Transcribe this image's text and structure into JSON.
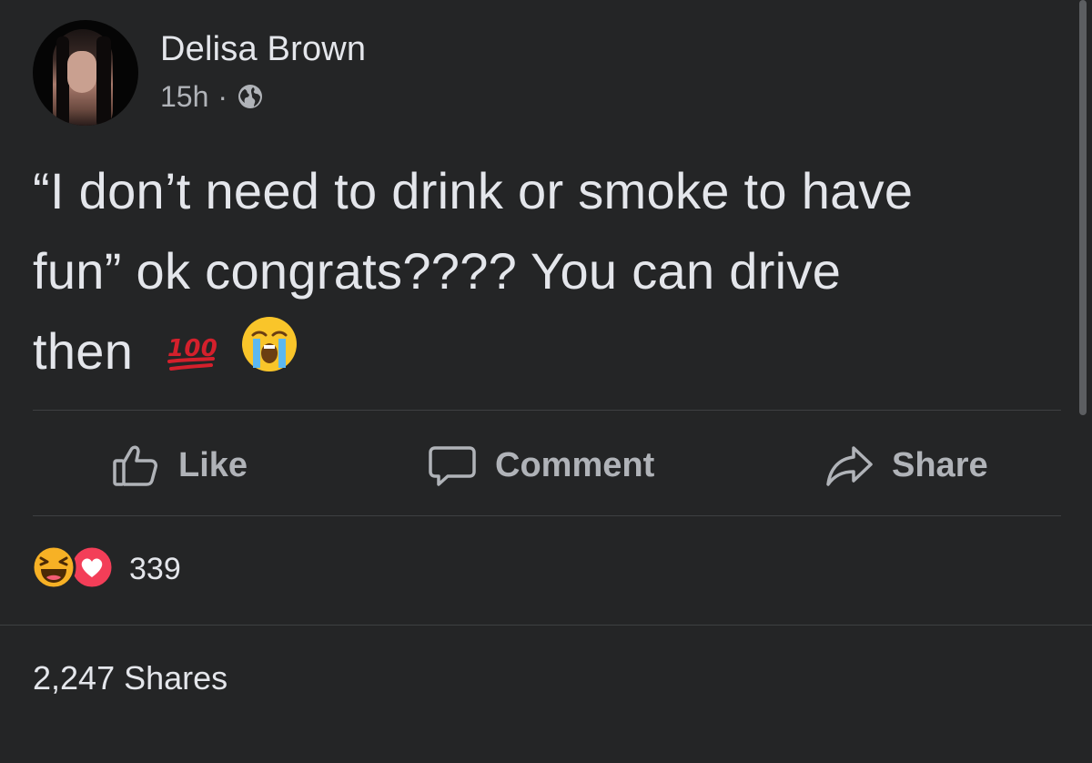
{
  "author": {
    "name": "Delisa Brown",
    "time": "15h",
    "separator": "·",
    "audience_icon": "globe-icon"
  },
  "post": {
    "text_line1": "“I don’t need to drink or smoke to have",
    "text_line2": "fun” ok congrats???? You can drive",
    "text_line3": "then",
    "emojis": [
      "hundred-points-emoji",
      "loudly-crying-face-emoji"
    ]
  },
  "actions": {
    "like_label": "Like",
    "comment_label": "Comment",
    "share_label": "Share"
  },
  "reactions": {
    "icons": [
      "haha-reaction-icon",
      "love-reaction-icon"
    ],
    "count": "339"
  },
  "stats": {
    "shares": "2,247 Shares"
  },
  "colors": {
    "background": "#242526",
    "primary_text": "#e4e6eb",
    "secondary_text": "#b0b3b8",
    "divider": "#3e4042",
    "love_red": "#f33e58",
    "haha_yellow": "#f7b125"
  }
}
